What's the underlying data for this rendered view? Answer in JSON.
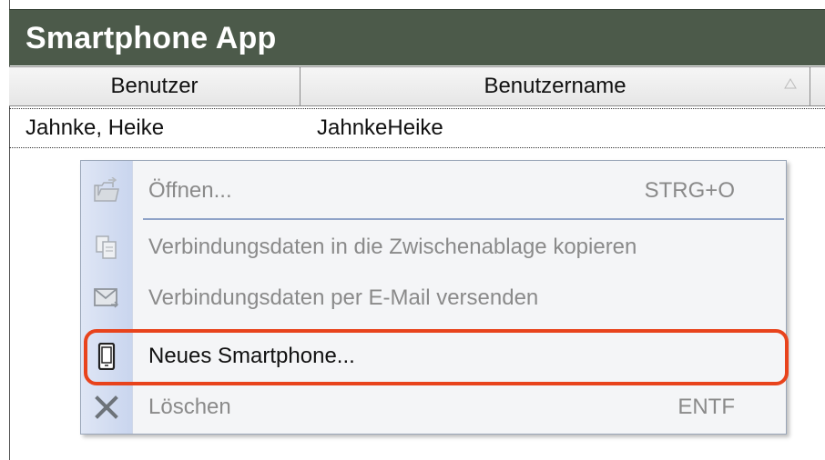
{
  "window": {
    "title": "Smartphone App"
  },
  "table": {
    "columns": [
      "Benutzer",
      "Benutzername"
    ],
    "rows": [
      {
        "benutzer": "Jahnke, Heike",
        "benutzername": "JahnkeHeike"
      }
    ]
  },
  "context_menu": {
    "items": [
      {
        "label": "Öffnen...",
        "shortcut": "STRG+O",
        "icon": "folder-open-icon",
        "enabled": false
      },
      {
        "label": "Verbindungsdaten in die Zwischenablage kopieren",
        "shortcut": "",
        "icon": "copy-icon",
        "enabled": false
      },
      {
        "label": "Verbindungsdaten per E-Mail versenden",
        "shortcut": "",
        "icon": "mail-icon",
        "enabled": false
      },
      {
        "label": "Neues Smartphone...",
        "shortcut": "",
        "icon": "smartphone-icon",
        "enabled": true
      },
      {
        "label": "Löschen",
        "shortcut": "ENTF",
        "icon": "delete-icon",
        "enabled": false
      }
    ]
  },
  "colors": {
    "titlebar": "#4c5a4a",
    "highlight": "#e8431c",
    "menu_gutter": "#c9d5ee"
  }
}
